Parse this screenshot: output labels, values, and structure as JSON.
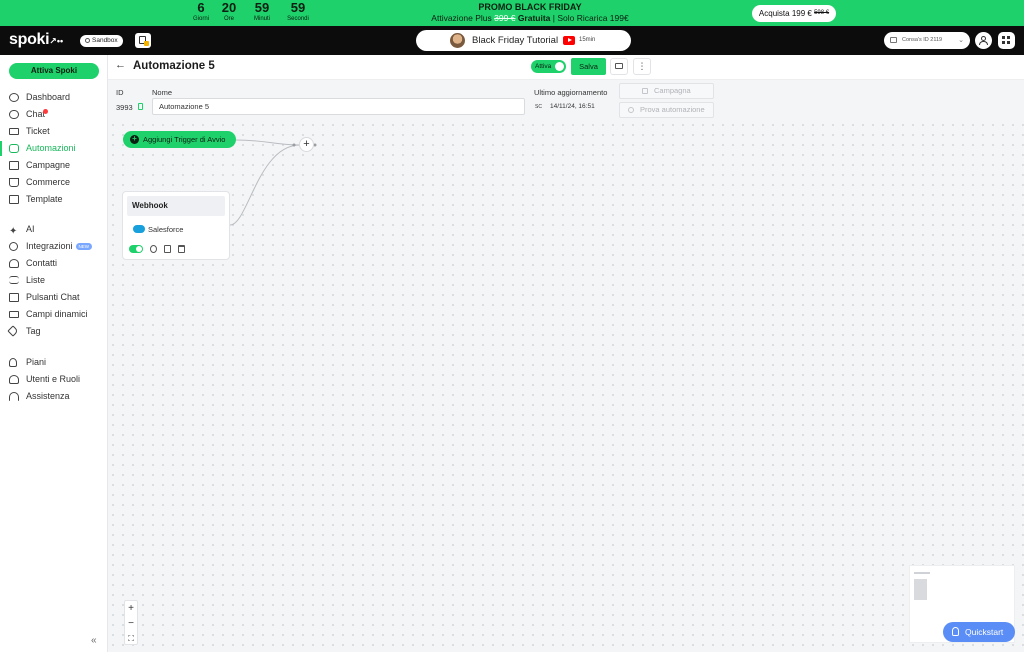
{
  "promo": {
    "countdown": [
      {
        "value": "6",
        "label": "Giorni"
      },
      {
        "value": "20",
        "label": "Ore"
      },
      {
        "value": "59",
        "label": "Minuti"
      },
      {
        "value": "59",
        "label": "Secondi"
      }
    ],
    "title": "PROMO BLACK FRIDAY",
    "line_prefix": "Attivazione Plus",
    "old_price": "399 €",
    "free_label": "Gratuita",
    "line_suffix": "| Solo Ricarica 199€",
    "buy_label": "Acquista 199 €",
    "buy_old_price": "598 €"
  },
  "topnav": {
    "logo": "spoki",
    "sandbox_label": "Sandbox",
    "tutorial_title": "Black Friday Tutorial",
    "tutorial_duration": "15min",
    "account_label": "Consa's ID 2119"
  },
  "sidebar": {
    "activate_label": "Attiva Spoki",
    "items": [
      {
        "label": "Dashboard",
        "icon": "dashboard-icon"
      },
      {
        "label": "Chat",
        "icon": "chat-icon"
      },
      {
        "label": "Ticket",
        "icon": "ticket-icon"
      },
      {
        "label": "Automazioni",
        "icon": "automation-icon"
      },
      {
        "label": "Campagne",
        "icon": "megaphone-icon"
      },
      {
        "label": "Commerce",
        "icon": "cart-icon"
      },
      {
        "label": "Template",
        "icon": "template-icon"
      },
      {
        "label": "AI",
        "icon": "sparkle-icon"
      },
      {
        "label": "Integrazioni",
        "icon": "plug-icon"
      },
      {
        "label": "Contatti",
        "icon": "contacts-icon"
      },
      {
        "label": "Liste",
        "icon": "list-icon"
      },
      {
        "label": "Pulsanti Chat",
        "icon": "chat-button-icon"
      },
      {
        "label": "Campi dinamici",
        "icon": "dynamic-fields-icon"
      },
      {
        "label": "Tag",
        "icon": "tag-icon"
      },
      {
        "label": "Piani",
        "icon": "rocket-icon"
      },
      {
        "label": "Utenti e Ruoli",
        "icon": "users-icon"
      },
      {
        "label": "Assistenza",
        "icon": "headset-icon"
      }
    ],
    "active_item": "Automazioni",
    "new_badge": "NEW",
    "collapse_glyph": "«"
  },
  "header": {
    "title": "Automazione 5",
    "toggle_label": "Attiva",
    "save_label": "Salva",
    "more_glyph": "⋮"
  },
  "info": {
    "id_label": "ID",
    "id_value": "3993",
    "name_label": "Nome",
    "name_value": "Automazione 5",
    "updated_label": "Ultimo aggiornamento",
    "updated_initials": "SC",
    "updated_date": "14/11/24, 16:51",
    "campaign_button": "Campagna",
    "test_button": "Prova automazione"
  },
  "canvas": {
    "trigger_label": "Aggiungi Trigger di Avvio",
    "webhook_title": "Webhook",
    "webhook_integration": "Salesforce",
    "zoom_in": "+",
    "zoom_out": "−",
    "fit": "⛶",
    "quickstart_label": "Quickstart"
  },
  "colors": {
    "brand_green": "#1fd16a",
    "dark_nav": "#0c0c0c",
    "quickstart_blue": "#5a8df5",
    "salesforce_blue": "#17a0db"
  }
}
